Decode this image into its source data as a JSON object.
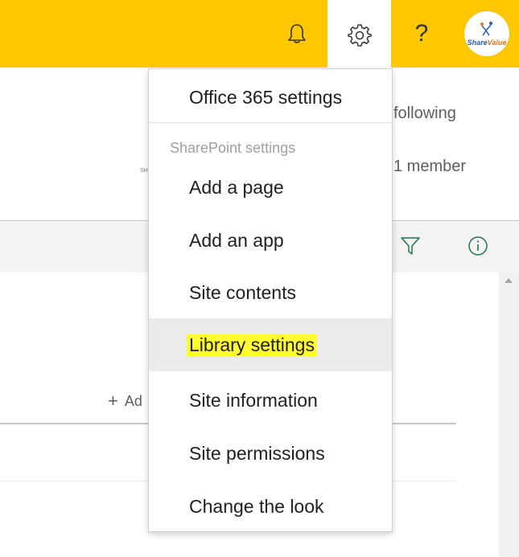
{
  "topbar": {
    "bg_color": "#ffc800",
    "buttons": [
      {
        "name": "notifications",
        "icon": "bell-icon"
      },
      {
        "name": "settings",
        "icon": "gear-icon"
      },
      {
        "name": "help",
        "label": "?"
      },
      {
        "name": "avatar",
        "logo_text_1": "Share",
        "logo_text_2": "Value"
      }
    ]
  },
  "background": {
    "following": "following",
    "member": "1 member",
    "tiny": "SH",
    "add_column": "Ad",
    "add_plus": "+"
  },
  "settings_menu": {
    "office365": "Office 365 settings",
    "section_label": "SharePoint settings",
    "items": [
      {
        "label": "Add a page"
      },
      {
        "label": "Add an app"
      },
      {
        "label": "Site contents"
      },
      {
        "label": "Library settings",
        "highlighted": true
      },
      {
        "label": "Site information"
      },
      {
        "label": "Site permissions"
      },
      {
        "label": "Change the look"
      }
    ]
  }
}
